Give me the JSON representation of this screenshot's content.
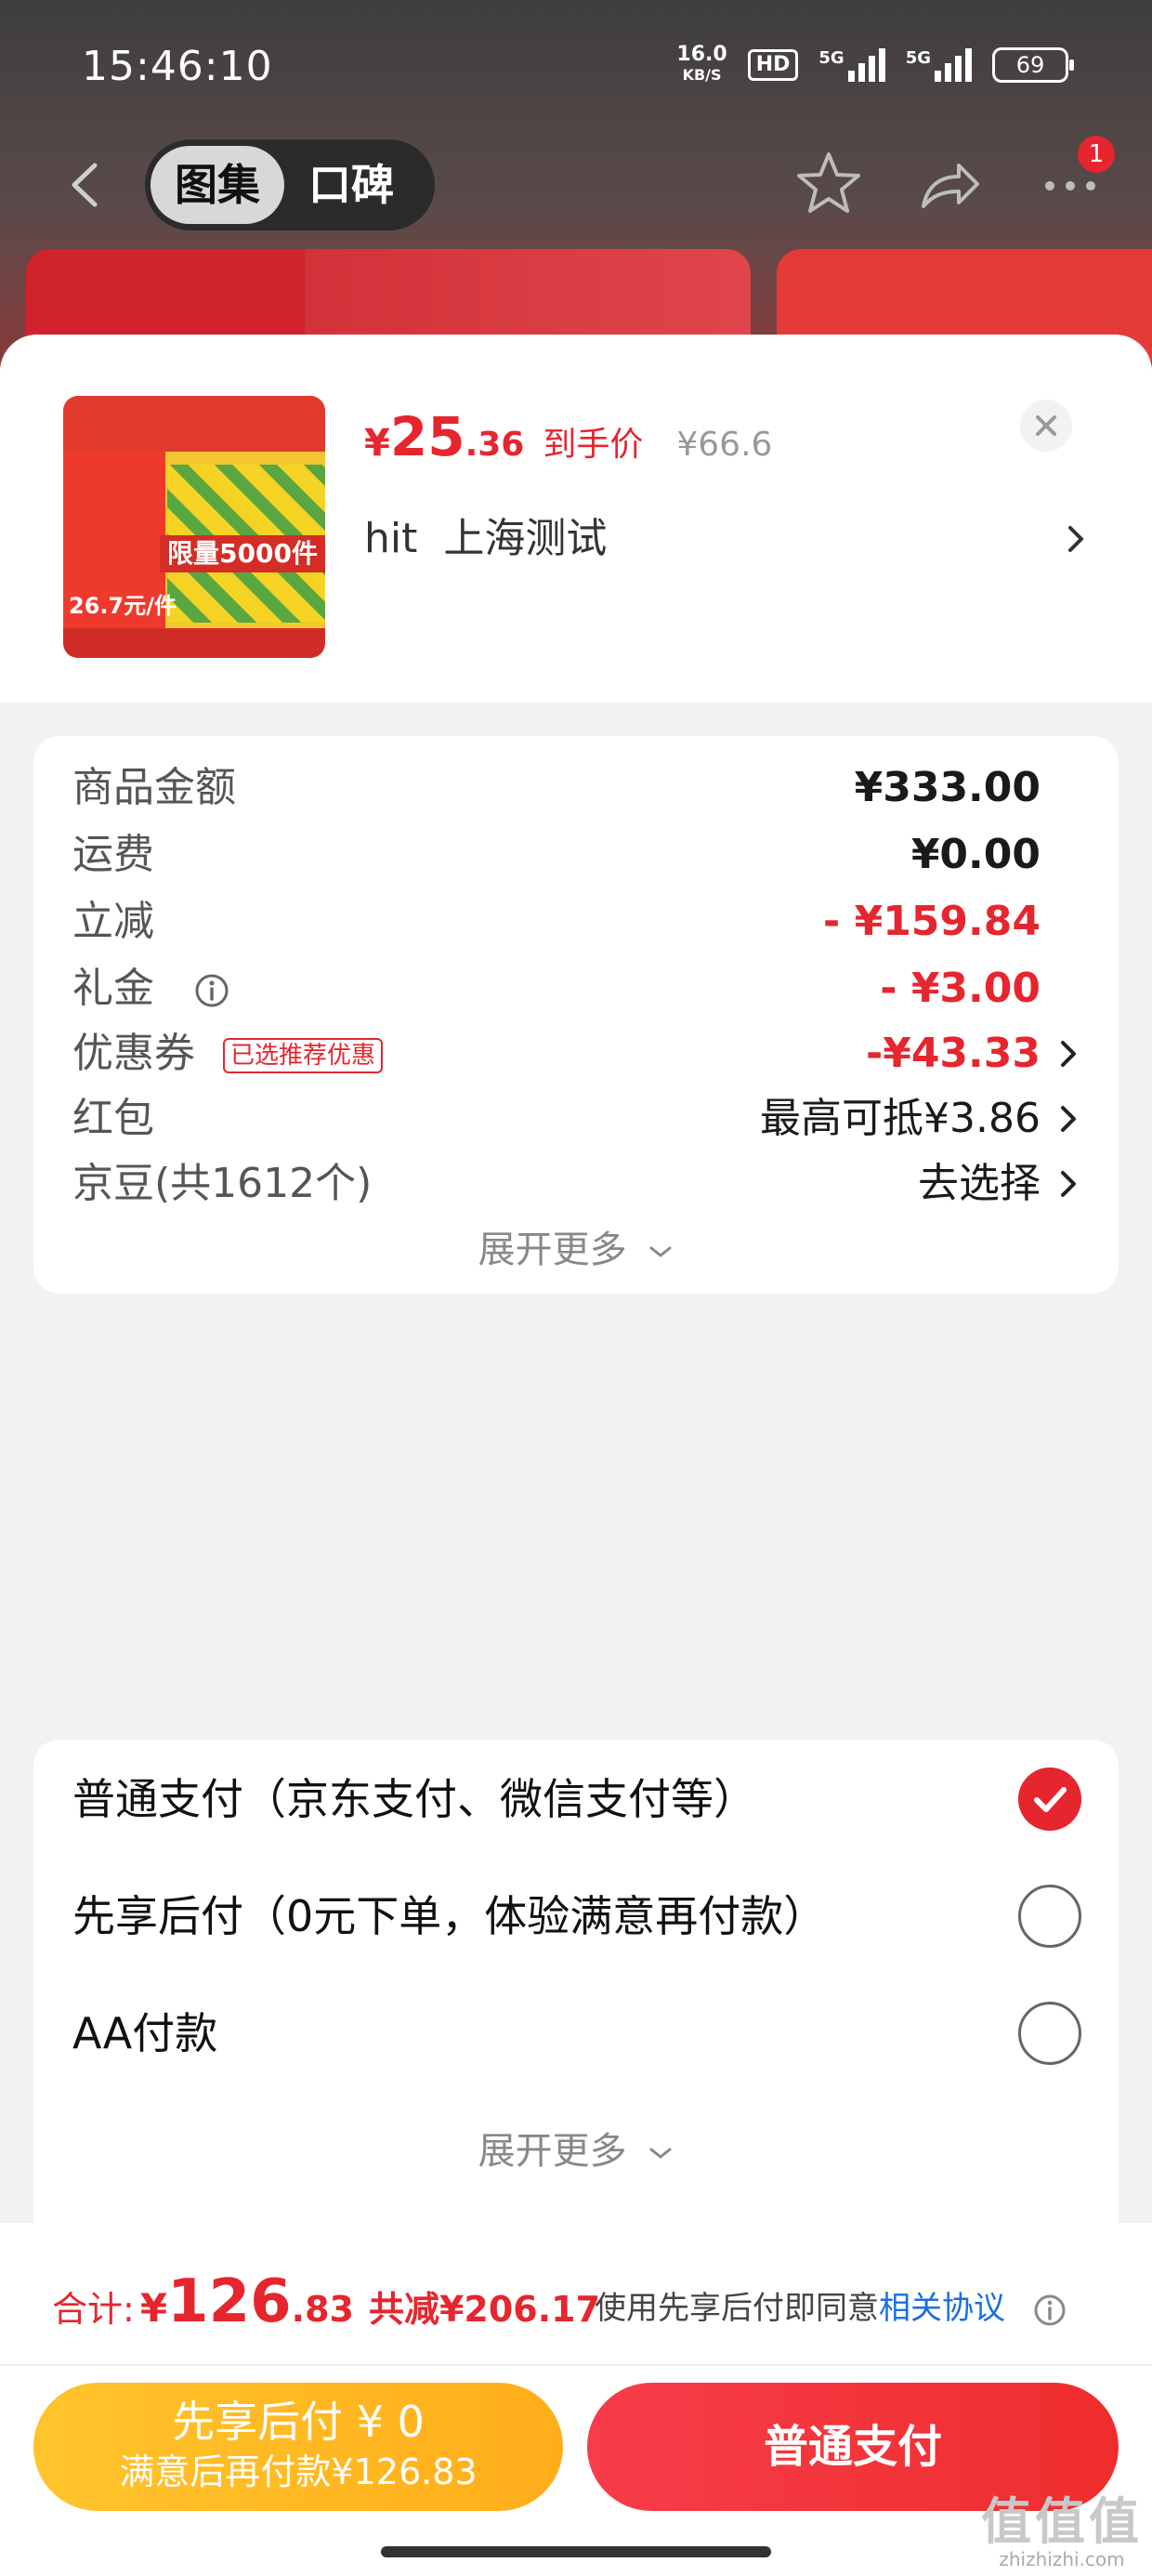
{
  "status_bar": {
    "time": "15:46:10",
    "net_speed_value": "16.0",
    "net_speed_unit": "KB/S",
    "hd_label": "HD",
    "signal_1": "5G",
    "signal_2": "5G",
    "battery": "69"
  },
  "nav": {
    "tabs": [
      {
        "label": "图集",
        "active": true
      },
      {
        "label": "口碑",
        "active": false
      }
    ],
    "notification_count": "1",
    "icons": [
      "back-icon",
      "star-icon",
      "share-icon",
      "more-icon"
    ]
  },
  "product": {
    "image_banner": "限量5000件",
    "image_price": "26.7元/件",
    "price_currency": "¥",
    "price_int": "25",
    "price_dec": ".36",
    "price_tag": "到手价",
    "original_price": "¥66.6",
    "variant": "hit  上海测试"
  },
  "summary": {
    "rows": [
      {
        "label": "商品金额",
        "value": "¥333.00"
      },
      {
        "label": "运费",
        "value": "¥0.00"
      },
      {
        "label": "立减",
        "value": "- ¥159.84"
      },
      {
        "label": "礼金",
        "value": "- ¥3.00"
      },
      {
        "label": "优惠券",
        "tag": "已选推荐优惠",
        "value": "-¥43.33"
      },
      {
        "label": "红包",
        "value": "最高可抵¥3.86"
      },
      {
        "label": "京豆(共1612个)",
        "value": "去选择"
      }
    ],
    "expand_label": "展开更多"
  },
  "payment": {
    "options": [
      {
        "label": "普通支付（京东支付、微信支付等）",
        "selected": true
      },
      {
        "label": "先享后付（0元下单，体验满意再付款）",
        "selected": false
      },
      {
        "label": "AA付款",
        "selected": false
      }
    ],
    "expand_label": "展开更多"
  },
  "footer": {
    "total_label": "合计:",
    "total_currency": "¥",
    "total_int": "126",
    "total_dec": ".83",
    "total_saved": "共减¥206.17",
    "agree_text": "使用先享后付即同意",
    "agree_link": "相关协议",
    "bnpl_line1": "先享后付 ¥ 0",
    "bnpl_line2": "满意后再付款¥126.83",
    "pay_button": "普通支付"
  },
  "watermark": {
    "logo": "值值值",
    "url": "zhizhizhi.com"
  },
  "colors": {
    "accent_red": "#e5262f",
    "bnpl_yellow": "#ffb81f",
    "link_blue": "#1a6fe0"
  }
}
